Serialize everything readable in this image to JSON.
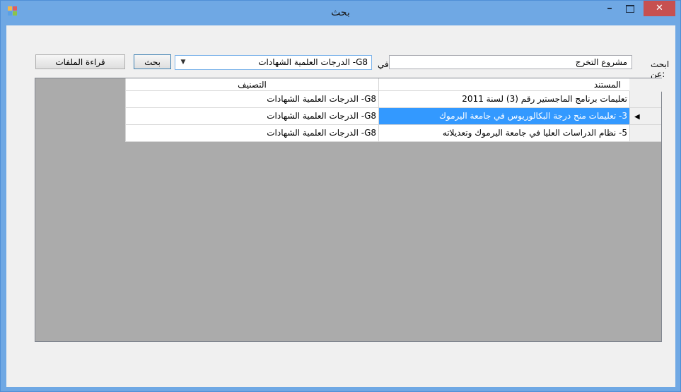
{
  "window": {
    "title": "بحث",
    "controls": {
      "minimize": "–",
      "close": "✕"
    }
  },
  "search": {
    "label": "ابحث عن:",
    "value": "مشروع التخرج",
    "in_label": "في",
    "category_selected": "G8- الدرجات العلمية الشهادات"
  },
  "buttons": {
    "search": "بحث",
    "read_files": "قراءة الملفات"
  },
  "grid": {
    "columns": [
      "المستند",
      "التصنيف"
    ],
    "rows": [
      {
        "document": "تعليمات برنامج الماجستير رقم (3) لسنة 2011",
        "category": "G8- الدرجات العلمية الشهادات",
        "selected": false
      },
      {
        "document": "3- تعليمات منح درجة البكالوريوس في جامعة اليرموك",
        "category": "G8- الدرجات العلمية الشهادات",
        "selected": true
      },
      {
        "document": "5- نظام الدراسات العليا في جامعة اليرموك وتعديلاته",
        "category": "G8- الدرجات العلمية الشهادات",
        "selected": false
      }
    ]
  },
  "colors": {
    "titlebar": "#6fa8e4",
    "close": "#c75050",
    "selection": "#3399ff",
    "grid_background": "#ababab"
  }
}
